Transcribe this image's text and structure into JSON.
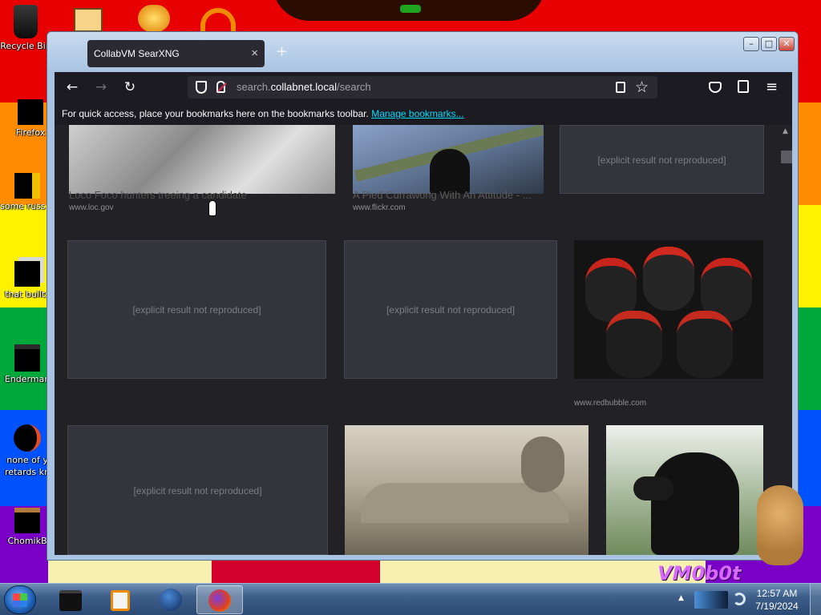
{
  "desktop": {
    "wallpaper_colors": [
      "#e80000",
      "#ff8b00",
      "#fff200",
      "#00a83b",
      "#0052ff",
      "#7a00c8"
    ],
    "icons": [
      {
        "label": "Recycle Bin"
      },
      {
        "label": "Firefox"
      },
      {
        "label": "some russ ran a re"
      },
      {
        "label": "that builts"
      },
      {
        "label": "Enderman"
      },
      {
        "label": "none of y retards kn"
      },
      {
        "label": "ChomikB"
      }
    ],
    "wallpaper_text": "VM0b0t"
  },
  "browser": {
    "tab_title": "CollabVM SearXNG",
    "tab_close": "×",
    "new_tab": "+",
    "url_prefix": "search.",
    "url_domain": "collabnet.local",
    "url_path": "/search",
    "bookmarks_text": "For quick access, place your bookmarks here on the bookmarks toolbar.",
    "bookmarks_link": "Manage bookmarks..."
  },
  "withheld_label": "[explicit result not reproduced]",
  "results": [
    {
      "title": "Loco Foco hunters treeing a candidate",
      "source": "www.loc.gov",
      "dimensions": ""
    },
    {
      "title": "A Pied Currawong With An Attitude - ...",
      "source": "www.flickr.com",
      "dimensions": ""
    },
    {
      "title": "",
      "source": "",
      "dimensions": "",
      "withheld": true
    },
    {
      "title": "",
      "source": "",
      "dimensions": "",
      "withheld": true
    },
    {
      "title": "",
      "source": "",
      "dimensions": "",
      "withheld": true
    },
    {
      "title": "",
      "source": "www.redbubble.com",
      "dimensions": ""
    },
    {
      "title": "",
      "source": "",
      "dimensions": "",
      "withheld": true
    },
    {
      "title": "",
      "source": "",
      "dimensions": ""
    },
    {
      "title": "",
      "source": "",
      "dimensions": ""
    }
  ],
  "taskbar": {
    "time": "12:57 AM",
    "date": "7/19/2024"
  }
}
